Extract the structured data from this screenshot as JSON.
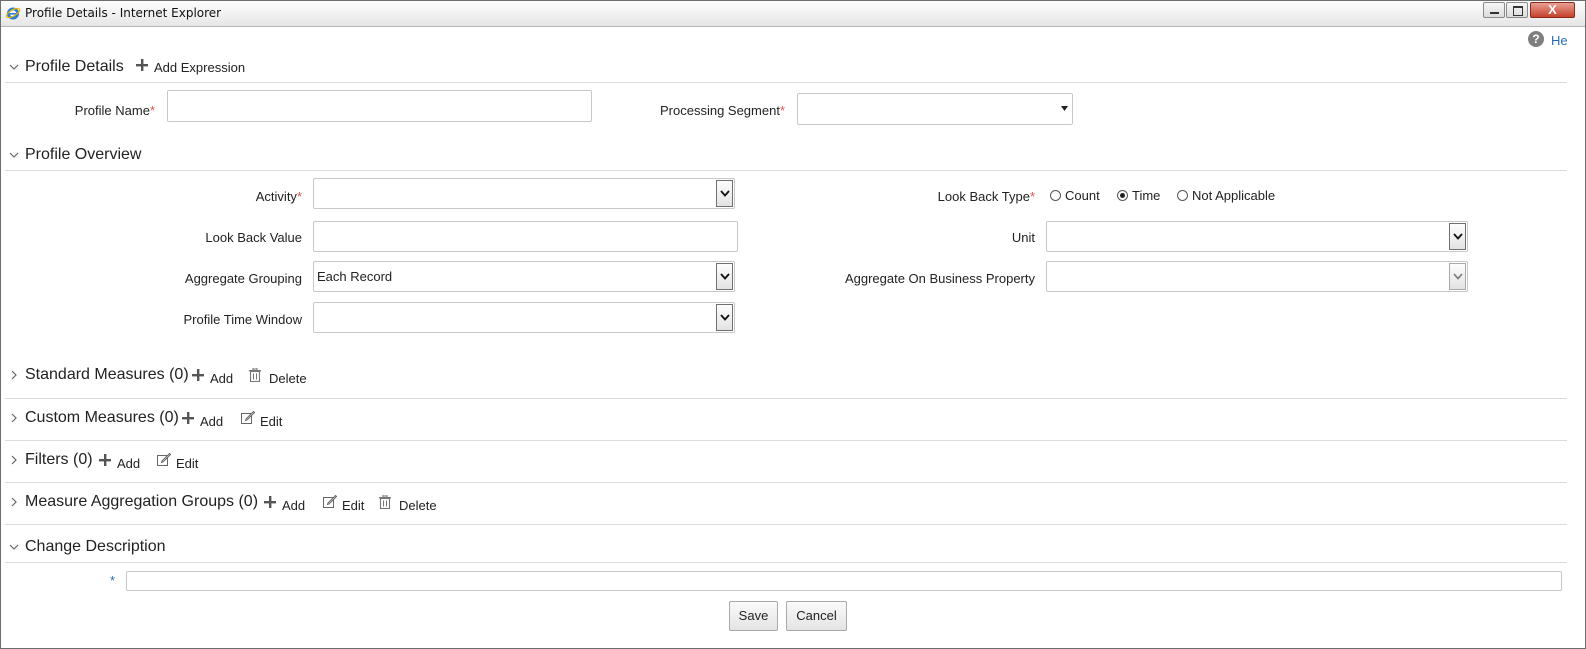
{
  "window": {
    "title": "Profile Details - Internet Explorer",
    "close_glyph": "X",
    "icons": [
      "ie-logo-icon",
      "minimize-icon",
      "maximize-icon",
      "close-icon"
    ]
  },
  "help": {
    "glyph": "?",
    "label": "He"
  },
  "profile_details": {
    "title": "Profile Details",
    "add_expression": "Add Expression",
    "profile_name_label": "Profile Name",
    "profile_name_value": "",
    "processing_segment_label": "Processing Segment",
    "processing_segment_value": "",
    "required_mark": "*"
  },
  "profile_overview": {
    "title": "Profile Overview",
    "activity_label": "Activity",
    "activity_value": "",
    "look_back_type_label": "Look Back Type",
    "look_back_type_options": [
      "Count",
      "Time",
      "Not Applicable"
    ],
    "look_back_type_selected": "Time",
    "look_back_value_label": "Look Back Value",
    "look_back_value": "",
    "unit_label": "Unit",
    "unit_value": "",
    "aggregate_grouping_label": "Aggregate Grouping",
    "aggregate_grouping_value": "Each Record",
    "aggregate_on_business_property_label": "Aggregate On Business Property",
    "aggregate_on_business_property_value": "",
    "profile_time_window_label": "Profile Time Window",
    "profile_time_window_value": ""
  },
  "sections": {
    "standard_measures": {
      "title": "Standard Measures",
      "count": "(0)",
      "add": "Add",
      "delete": "Delete"
    },
    "custom_measures": {
      "title": "Custom Measures",
      "count": "(0)",
      "add": "Add",
      "edit": "Edit"
    },
    "filters": {
      "title": "Filters",
      "count": "(0)",
      "add": "Add",
      "edit": "Edit"
    },
    "measure_aggregation_groups": {
      "title": "Measure Aggregation Groups",
      "count": "(0)",
      "add": "Add",
      "edit": "Edit",
      "delete": "Delete"
    }
  },
  "change_description": {
    "title": "Change Description",
    "required_mark": "*",
    "value": ""
  },
  "footer": {
    "save": "Save",
    "cancel": "Cancel"
  },
  "colors": {
    "required": "#d9534f",
    "link": "#2a6ebb",
    "divider": "#d8dce0"
  }
}
